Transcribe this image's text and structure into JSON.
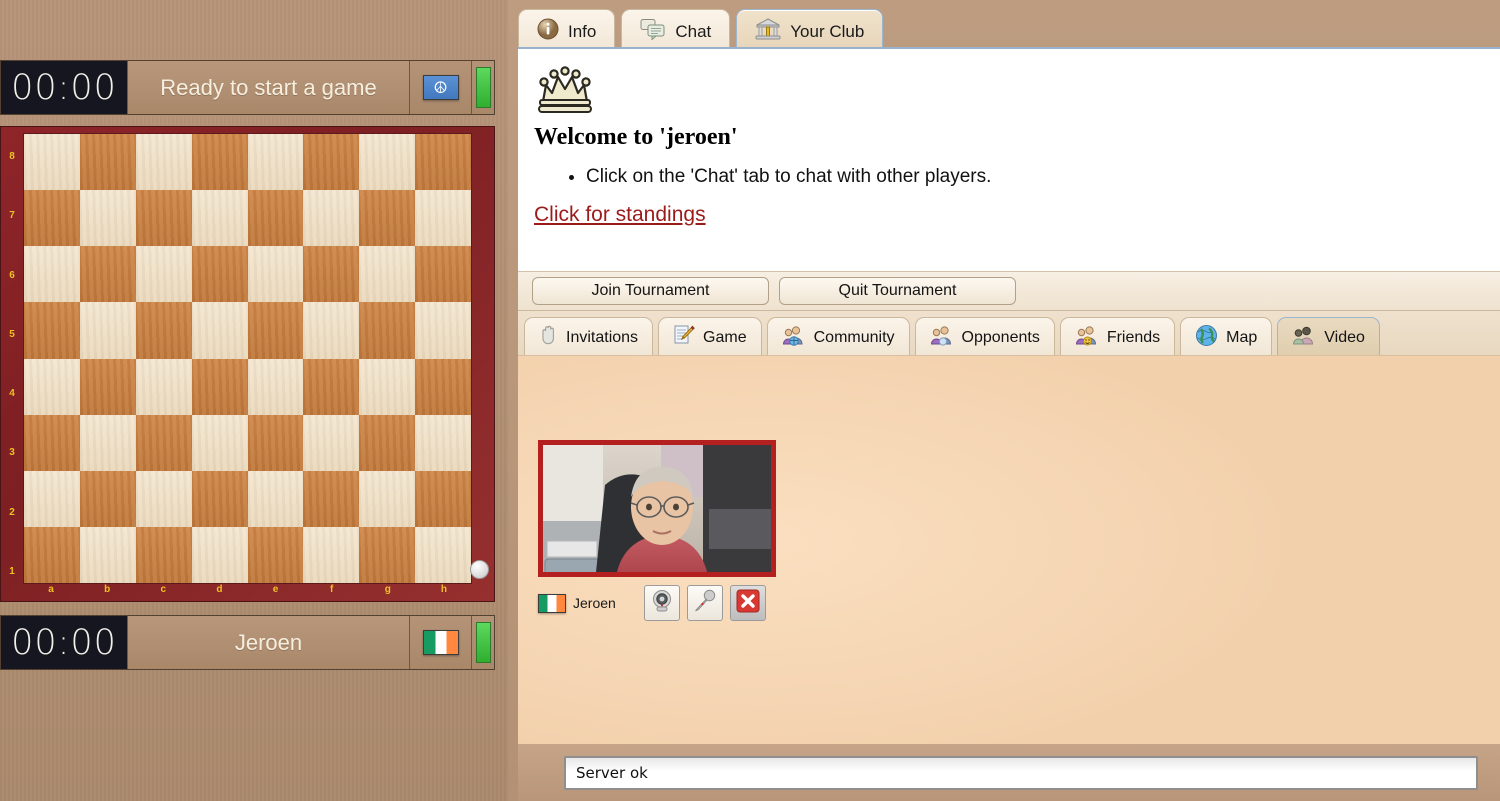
{
  "clocks": {
    "top": {
      "time": "00:00",
      "label": "Ready to start a game",
      "flag": "un-flag",
      "lamp": "green"
    },
    "bottom": {
      "time": "00:00",
      "label": "Jeroen",
      "flag": "ireland-flag",
      "lamp": "green"
    }
  },
  "board": {
    "ranks": [
      "8",
      "7",
      "6",
      "5",
      "4",
      "3",
      "2",
      "1"
    ],
    "files": [
      "a",
      "b",
      "c",
      "d",
      "e",
      "f",
      "g",
      "h"
    ],
    "turn_indicator": "white"
  },
  "top_tabs": [
    {
      "label": "Info",
      "icon": "info-icon",
      "active": false
    },
    {
      "label": "Chat",
      "icon": "chat-bubbles-icon",
      "active": false
    },
    {
      "label": "Your Club",
      "icon": "bank-building-icon",
      "active": true
    }
  ],
  "welcome": {
    "icon": "chess-queen-crown-icon",
    "title": "Welcome to 'jeroen'",
    "bullets": [
      "Click on the 'Chat' tab to chat with other players."
    ],
    "standings_link": "Click for standings"
  },
  "tournament": {
    "join_label": "Join Tournament",
    "quit_label": "Quit Tournament"
  },
  "sub_tabs": [
    {
      "label": "Invitations",
      "icon": "hand-icon",
      "active": false
    },
    {
      "label": "Game",
      "icon": "document-pencil-icon",
      "active": false
    },
    {
      "label": "Community",
      "icon": "people-globe-icon",
      "active": false
    },
    {
      "label": "Opponents",
      "icon": "people-icon",
      "active": false
    },
    {
      "label": "Friends",
      "icon": "people-smiley-icon",
      "active": false
    },
    {
      "label": "Map",
      "icon": "globe-icon",
      "active": false
    },
    {
      "label": "Video",
      "icon": "people-video-icon",
      "active": true
    }
  ],
  "video_panel": {
    "webcam": {
      "name": "Jeroen",
      "flag": "ireland-flag",
      "controls": [
        {
          "name": "webcam-toggle",
          "icon": "webcam-icon"
        },
        {
          "name": "microphone-toggle",
          "icon": "microphone-icon"
        },
        {
          "name": "close-stream",
          "icon": "close-x-icon"
        }
      ]
    }
  },
  "status": {
    "message": "Server ok"
  },
  "colors": {
    "accent_link": "#9b1b1b",
    "cam_border": "#b3201f",
    "tab_active_border": "#96b2cd",
    "board_light": "#f3e7d2",
    "board_dark": "#d08a4c",
    "board_frame": "#8e2529",
    "coord_text": "#f0c020",
    "panel_bg": "#f6d7b5",
    "wood_bg": "#b39174"
  }
}
